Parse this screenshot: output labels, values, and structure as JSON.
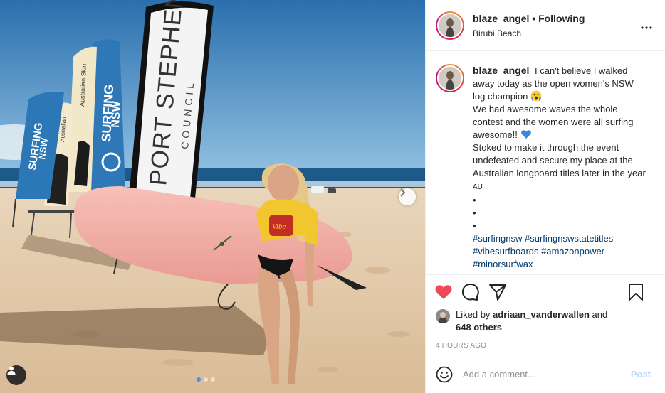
{
  "post": {
    "username": "blaze_angel",
    "follow_label": "Following",
    "separator": " • ",
    "location": "Birubi Beach",
    "more_icon": "more-options-icon"
  },
  "photo": {
    "banners": [
      "PORT STEPHENS",
      "COUNCIL",
      "SURFING",
      "NSW",
      "Australian Skin",
      "Australian",
      "SURFING",
      "NSW"
    ],
    "shirt_text": "Vibe",
    "carousel_dots": 3,
    "active_dot": 0
  },
  "caption": {
    "username": "blaze_angel",
    "lines": [
      "I can't believe I walked away today as the open women's NSW log champion",
      "We had awesome waves the whole contest and the women were all surfing awesome!!",
      "Stoked to make it through the event undefeated and secure my place at the Australian longboard titles later in the year",
      "AU",
      "•",
      "•",
      "•"
    ],
    "hashtags": [
      "#surfingnsw",
      "#surfingnswstatetitles",
      "#vibesurfboards",
      "#amazonpower",
      "#minorsurfwax"
    ]
  },
  "likes": {
    "prefix": "Liked by ",
    "user": "adriaan_vanderwallen",
    "middle": " and",
    "others": "648 others"
  },
  "timestamp": "4 HOURS AGO",
  "add_comment": {
    "placeholder": "Add a comment…",
    "post_label": "Post"
  },
  "colors": {
    "like_red": "#ed4956",
    "link_blue": "#00376b",
    "post_disabled": "#b3dbff",
    "board_pink": "#f3b0a8",
    "sky_blue": "#3b80bd"
  }
}
